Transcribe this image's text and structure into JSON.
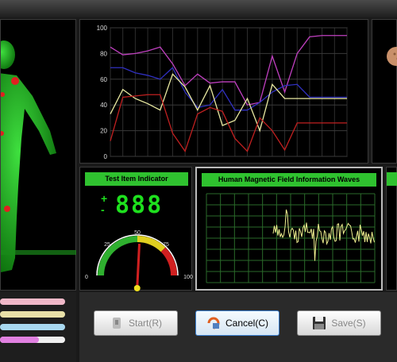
{
  "chart_data": {
    "type": "line",
    "x": [
      1,
      2,
      3,
      4,
      5,
      6,
      7,
      8,
      9,
      10,
      11,
      12,
      13,
      14,
      15,
      16,
      17,
      18,
      19,
      20
    ],
    "ylim": [
      0,
      100
    ],
    "yticks": [
      0,
      20,
      40,
      60,
      80,
      100
    ],
    "grid": true,
    "legend": "none",
    "series": [
      {
        "color": "#c040c0",
        "values": [
          85,
          79,
          80,
          82,
          85,
          72,
          55,
          64,
          57,
          58,
          58,
          40,
          42,
          78,
          50,
          80,
          93,
          94,
          94,
          94
        ]
      },
      {
        "color": "#3030c0",
        "values": [
          69,
          69,
          65,
          63,
          60,
          69,
          50,
          38,
          40,
          52,
          36,
          36,
          42,
          50,
          55,
          56,
          46,
          46,
          46,
          46
        ]
      },
      {
        "color": "#e8e8a0",
        "values": [
          33,
          52,
          45,
          41,
          36,
          64,
          54,
          36,
          55,
          24,
          28,
          45,
          20,
          56,
          45,
          45,
          45,
          45,
          45,
          45
        ]
      },
      {
        "color": "#c02020",
        "values": [
          12,
          46,
          47,
          48,
          48,
          18,
          4,
          33,
          38,
          35,
          14,
          4,
          30,
          20,
          5,
          26,
          26,
          26,
          26,
          26
        ]
      }
    ]
  },
  "wave": {
    "title": "Human Magnetic Field Information Waves"
  },
  "indicator": {
    "title": "Test Item Indicator",
    "plus": "+",
    "minus": "-",
    "digits": "888",
    "gauge_labels": [
      "0",
      "25",
      "50",
      "75",
      "100"
    ],
    "gauge_value": 52
  },
  "buttons": {
    "start": "Start(R)",
    "cancel": "Cancel(C)",
    "save": "Save(S)"
  },
  "sliders": [
    {
      "color": "#f0b8c8",
      "level": 1.0
    },
    {
      "color": "#e8e0a8",
      "level": 1.0
    },
    {
      "color": "#a8d8f0",
      "level": 1.0
    },
    {
      "color": "#e080e0",
      "level": 0.6
    }
  ]
}
